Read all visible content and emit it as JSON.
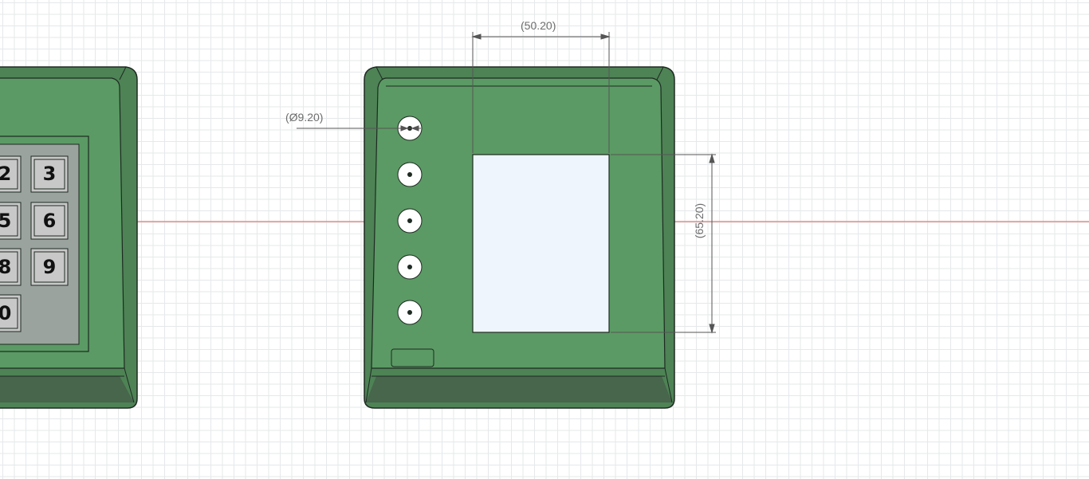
{
  "canvas": {
    "background": "#ffffff",
    "grid_color": "#e6e8ea",
    "axis_color": "#e05a5a"
  },
  "colors": {
    "enclosure_face": "#5b9a64",
    "enclosure_bevel": "#4e8355",
    "enclosure_bottom": "#47664b",
    "screen": "#eef5fc",
    "keypad_frame": "#9aa39d",
    "key_face": "#c8c8c8",
    "edge_line": "#1e2a22"
  },
  "keypad": {
    "keys": [
      "2",
      "3",
      "5",
      "6",
      "8",
      "9",
      "0"
    ]
  },
  "dimensions": {
    "width_label": "(50.20)",
    "height_label": "(65.20)",
    "diameter_label": "(Ø9.20)"
  },
  "leds": {
    "count": 5
  }
}
